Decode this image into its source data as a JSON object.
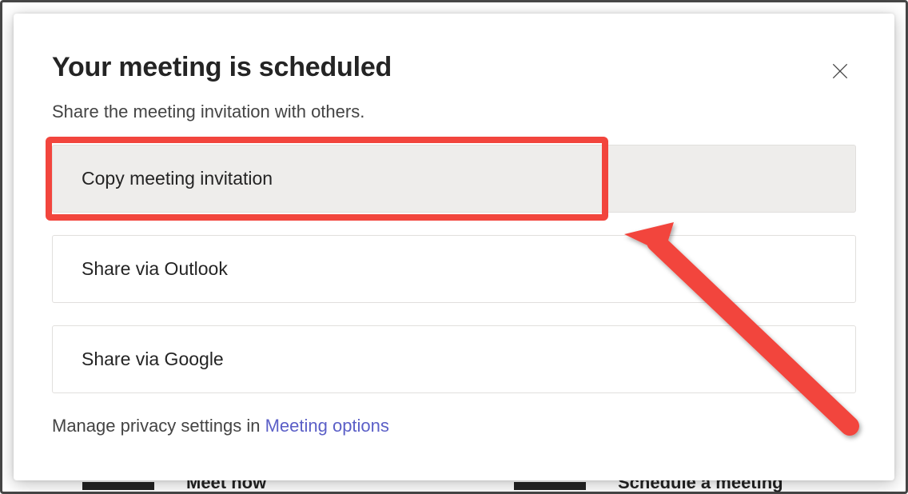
{
  "dialog": {
    "title": "Your meeting is scheduled",
    "subtitle": "Share the meeting invitation with others.",
    "options": {
      "copy": "Copy meeting invitation",
      "outlook": "Share via Outlook",
      "google": "Share via Google"
    },
    "footer_prefix": "Manage privacy settings in ",
    "footer_link": "Meeting options"
  },
  "background": {
    "left_text": "Meet now",
    "right_text": "Schedule a meeting"
  },
  "annotation": {
    "highlight_color": "#f2453d"
  }
}
